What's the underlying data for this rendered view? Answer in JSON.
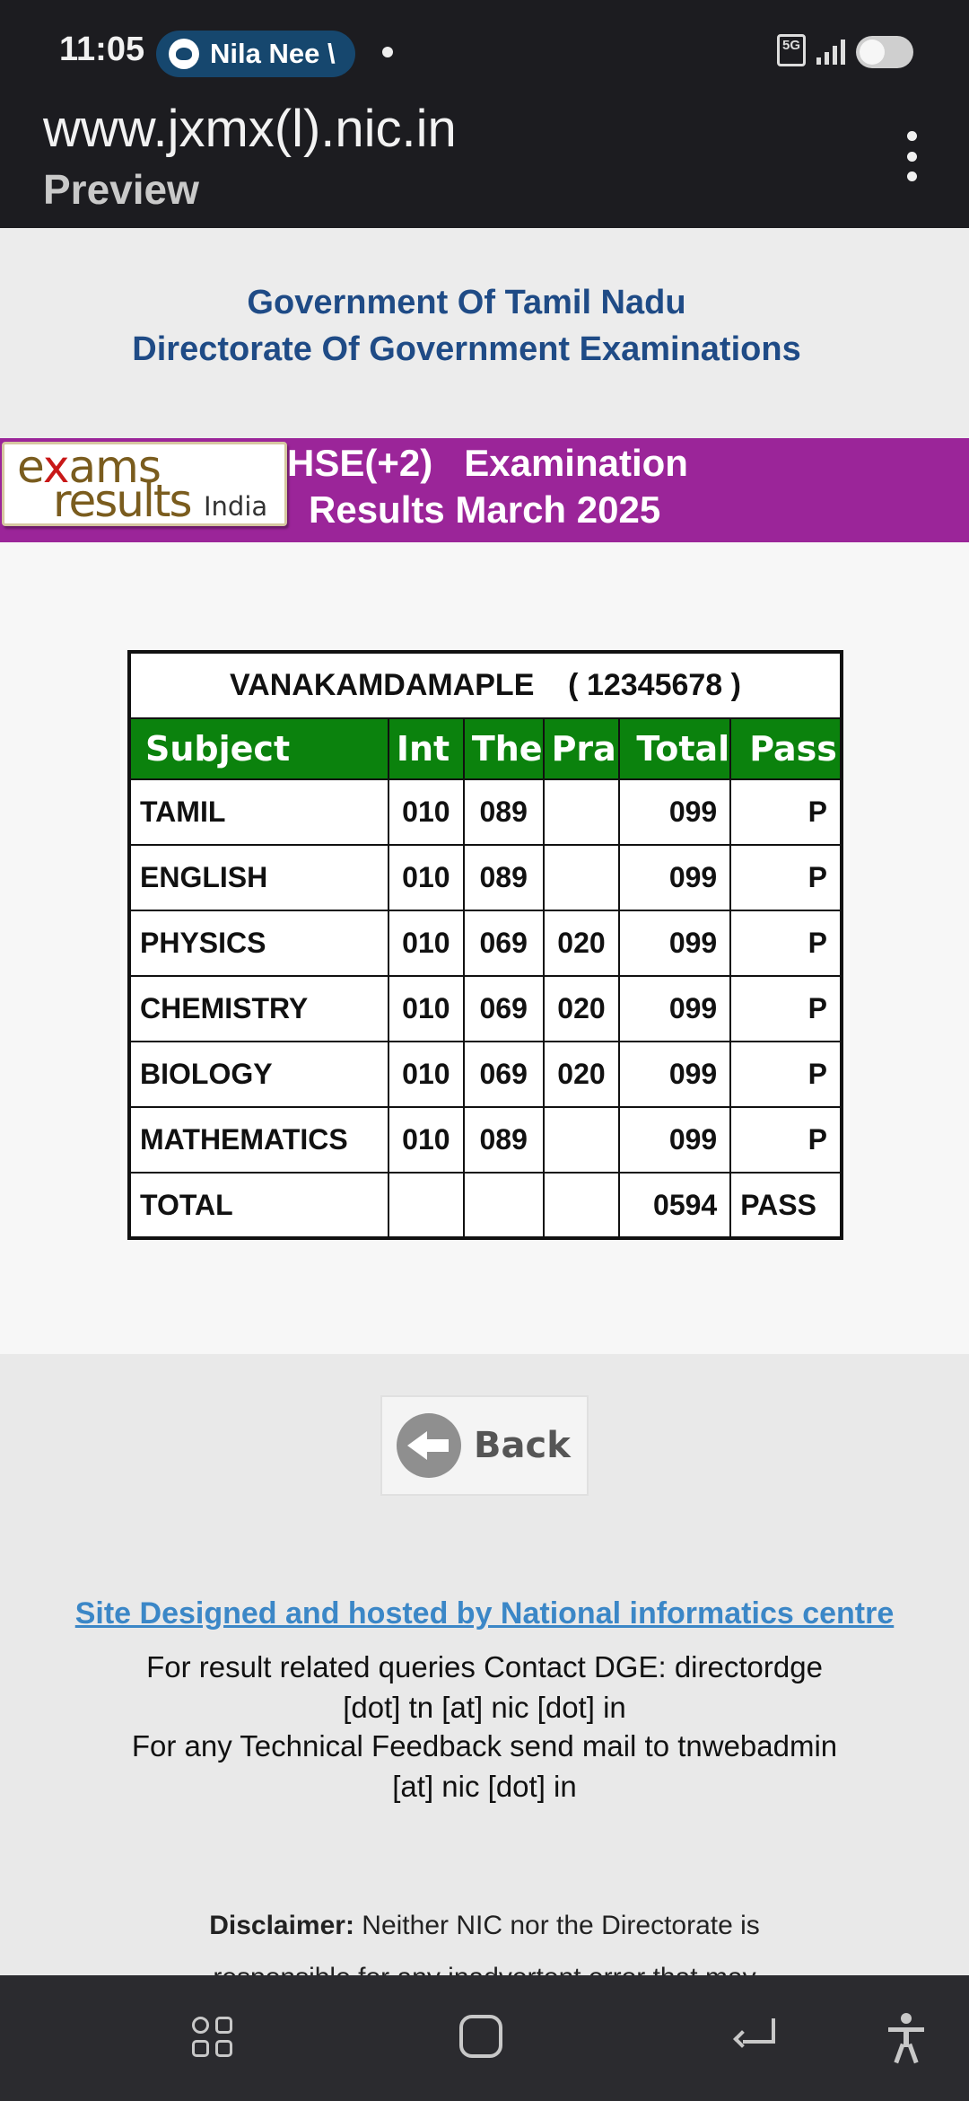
{
  "status_bar": {
    "time": "11:05",
    "notification": "Nila Nee \\",
    "network": "5G"
  },
  "browser": {
    "url": "www.jxmx(l).nic.in",
    "subtitle": "Preview",
    "menu_icon": "kebab-menu-icon"
  },
  "header": {
    "line1": "Government Of Tamil Nadu",
    "line2": "Directorate Of Government Examinations"
  },
  "banner": {
    "logo_exams_prefix": "e",
    "logo_exams_x": "x",
    "logo_exams_suffix": "ams",
    "logo_results": "results",
    "logo_india": "India",
    "title_line1": "HSE(+2)   Examination",
    "title_line2": "Results March 2025",
    "color": "#9b2599"
  },
  "result": {
    "candidate_name": "VANAKAMDAMAPLE",
    "candidate_roll": "( 12345678 )",
    "headers": [
      "Subject",
      "Int",
      "The",
      "Pra",
      "Total",
      "Pass"
    ],
    "header_color": "#0b820d",
    "rows": [
      {
        "subject": "TAMIL",
        "int": "010",
        "the": "089",
        "pra": "",
        "total": "099",
        "pass": "P"
      },
      {
        "subject": "ENGLISH",
        "int": "010",
        "the": "089",
        "pra": "",
        "total": "099",
        "pass": "P"
      },
      {
        "subject": "PHYSICS",
        "int": "010",
        "the": "069",
        "pra": "020",
        "total": "099",
        "pass": "P"
      },
      {
        "subject": "CHEMISTRY",
        "int": "010",
        "the": "069",
        "pra": "020",
        "total": "099",
        "pass": "P"
      },
      {
        "subject": "BIOLOGY",
        "int": "010",
        "the": "069",
        "pra": "020",
        "total": "099",
        "pass": "P"
      },
      {
        "subject": "MATHEMATICS",
        "int": "010",
        "the": "089",
        "pra": "",
        "total": "099",
        "pass": "P"
      }
    ],
    "total_row": {
      "label": "TOTAL",
      "total": "0594",
      "pass": "PASS"
    }
  },
  "back_button": {
    "label": "Back",
    "icon": "back-arrow-icon"
  },
  "footer": {
    "nic_link": "Site Designed and hosted by National informatics centre",
    "contact1_line1": "For result related queries Contact DGE: directordge",
    "contact1_line2": "[dot] tn [at] nic [dot] in",
    "contact2_line1": "For any Technical Feedback send mail to tnwebadmin",
    "contact2_line2": "[at] nic [dot] in",
    "disclaimer_label": "Disclaimer:",
    "disclaimer_line1": "Neither NIC nor the Directorate is",
    "disclaimer_line2": "responsible for any inadvertent error that may"
  },
  "nav": {
    "recents_icon": "recents-icon",
    "home_icon": "home-icon",
    "back_icon": "back-icon",
    "accessibility_icon": "accessibility-icon"
  }
}
